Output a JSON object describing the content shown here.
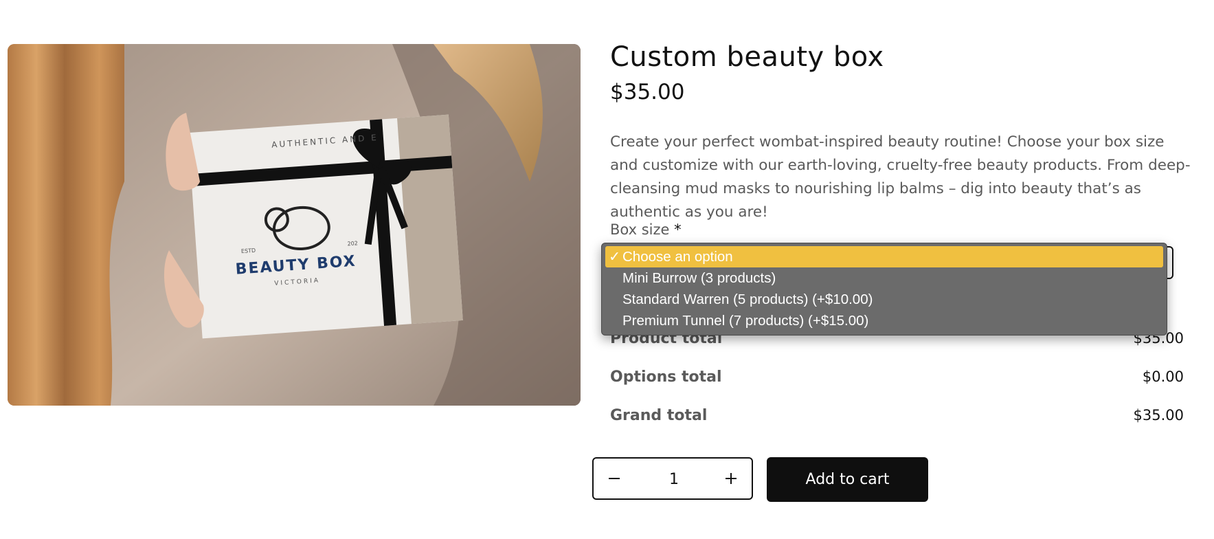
{
  "product": {
    "title": "Custom beauty box",
    "price": "$35.00",
    "description": "Create your perfect wombat-inspired beauty routine! Choose your box size and customize with our earth-loving, cruelty-free beauty products. From deep-cleansing mud masks to nourishing lip balms – dig into beauty that’s as authentic as you are!",
    "image": {
      "box_brand": "BEAUTY BOX",
      "box_location": "VICTORIA",
      "box_arc_text": "AUTHENTIC AND E",
      "box_est": "ESTD",
      "box_year": "202"
    }
  },
  "box_size": {
    "label": "Box size",
    "required_marker": "*",
    "options": [
      {
        "label": "Choose an option",
        "selected": true
      },
      {
        "label": "Mini Burrow (3 products)",
        "selected": false
      },
      {
        "label": "Standard Warren (5 products) (+$10.00)",
        "selected": false
      },
      {
        "label": "Premium Tunnel (7 products) (+$15.00)",
        "selected": false
      }
    ],
    "check_glyph": "✓",
    "highlight_color": "#f0c040"
  },
  "totals": {
    "product_total_label": "Product total",
    "product_total_value": "$35.00",
    "options_total_label": "Options total",
    "options_total_value": "$0.00",
    "grand_total_label": "Grand total",
    "grand_total_value": "$35.00"
  },
  "quantity": {
    "value": "1",
    "minus_icon": "minus-icon",
    "plus_icon": "plus-icon"
  },
  "cart": {
    "add_label": "Add to cart",
    "button_color": "#0f0f0f"
  }
}
